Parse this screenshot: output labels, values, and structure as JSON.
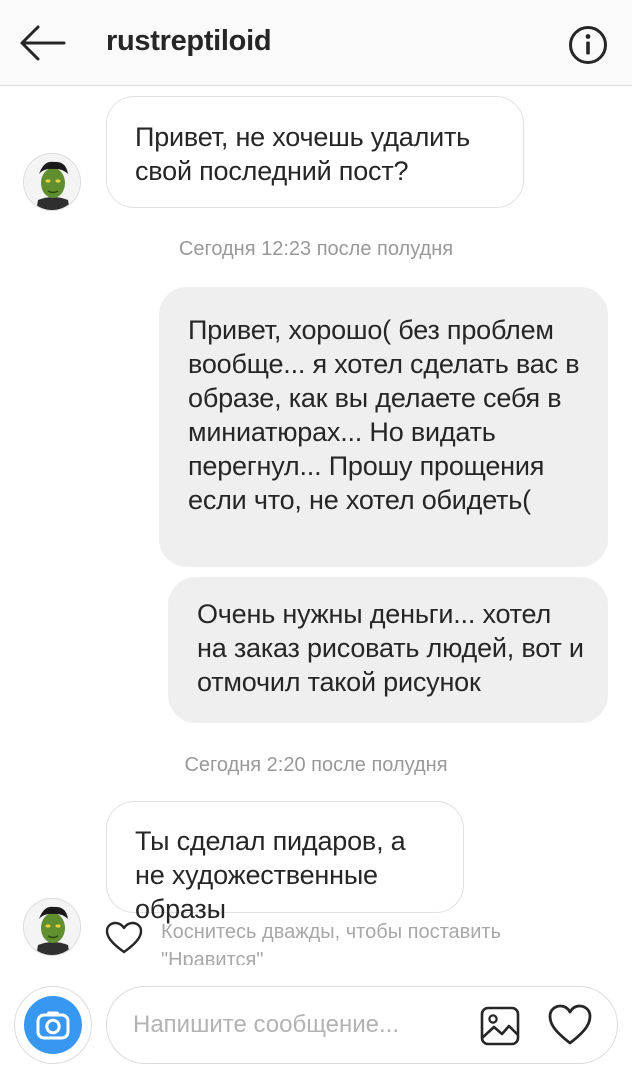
{
  "header": {
    "username": "rustreptiloid",
    "back_icon": "arrow-left-icon",
    "info_icon": "info-circle-icon"
  },
  "thread": {
    "messages": [
      {
        "direction": "incoming",
        "text": "Привет, не хочешь удалить свой последний пост?"
      },
      {
        "direction": "outgoing",
        "text": "Привет, хорошо( без проблем вообще... я хотел сделать вас в образе, как вы делаете себя в миниатюрах... Но видать перегнул... Прошу прощения если что, не хотел обидеть("
      },
      {
        "direction": "outgoing",
        "text": "Очень нужны деньги... хотел на заказ рисовать людей, вот и отмочил такой рисунок"
      },
      {
        "direction": "incoming",
        "text": "Ты сделал пидаров, а не художественные образы"
      }
    ],
    "timestamps": [
      "Сегодня 12:23 после полудня",
      "Сегодня 2:20 после полудня"
    ],
    "like_hint": "Коснитесь дважды, чтобы поставить \"Нравится\""
  },
  "composer": {
    "placeholder": "Напишите сообщение...",
    "camera_icon": "camera-icon",
    "gallery_icon": "gallery-icon",
    "heart_icon": "heart-icon"
  },
  "colors": {
    "accent": "#3897f0",
    "outgoing_bubble": "#efefef",
    "incoming_border": "#e1e1e1",
    "meta_text": "#999999"
  }
}
